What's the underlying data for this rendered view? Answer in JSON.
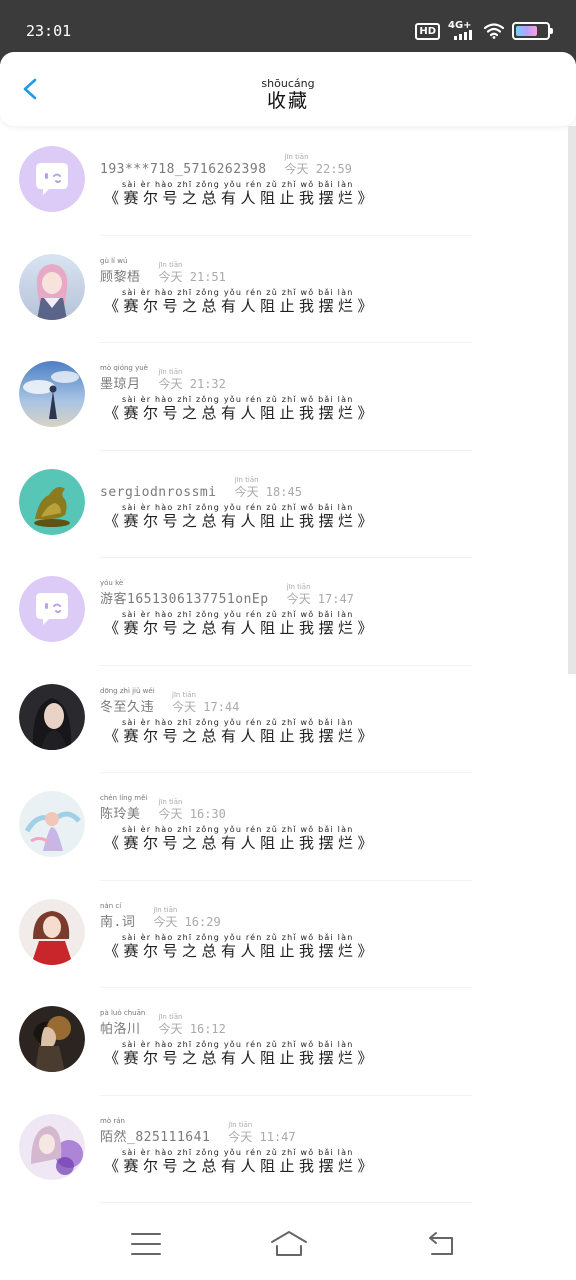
{
  "status": {
    "time": "23:01",
    "hd": "HD",
    "network": "4G+",
    "battery_level": 0.7,
    "icons": [
      "hd-icon",
      "signal-icon",
      "wifi-icon",
      "battery-icon"
    ]
  },
  "header": {
    "back_icon": "chevron-left-icon",
    "title_pinyin": "shōucáng",
    "title": "收藏",
    "accent": "#1e9be8"
  },
  "post": {
    "title": "《赛尔号之总有人阻止我摆烂》",
    "pinyin": "sài èr hào zhī zǒng yǒu rén zǔ zhǐ wǒ bǎi làn"
  },
  "items": [
    {
      "name": "193***718_5716262398",
      "name_pinyin": "",
      "time": "今天 22:59",
      "time_pinyin": "jīn tiān",
      "post": "《赛尔号之总有人阻止我摆烂》",
      "post_pinyin": "sài èr hào zhī zǒng yǒu rén zǔ zhǐ wǒ bǎi làn",
      "avatar": "default-chat-avatar"
    },
    {
      "name": "顾黎梧",
      "name_pinyin": "gù lí wú",
      "time": "今天 21:51",
      "time_pinyin": "jīn tiān",
      "post": "《赛尔号之总有人阻止我摆烂》",
      "post_pinyin": "sài èr hào zhī zǒng yǒu rén zǔ zhǐ wǒ bǎi làn",
      "avatar": "anime-girl-avatar"
    },
    {
      "name": "墨琼月",
      "name_pinyin": "mò qióng yuè",
      "time": "今天 21:32",
      "time_pinyin": "jīn tiān",
      "post": "《赛尔号之总有人阻止我摆烂》",
      "post_pinyin": "sài èr hào zhī zǒng yǒu rén zǔ zhǐ wǒ bǎi làn",
      "avatar": "sky-figure-avatar"
    },
    {
      "name": "sergiodnrossmi",
      "name_pinyin": "",
      "time": "今天 18:45",
      "time_pinyin": "jīn tiān",
      "post": "《赛尔号之总有人阻止我摆烂》",
      "post_pinyin": "sài èr hào zhī zǒng yǒu rén zǔ zhǐ wǒ bǎi làn",
      "avatar": "gold-dragon-avatar"
    },
    {
      "name": "游客1651306137751onEp",
      "name_pinyin": "yóu kè",
      "time": "今天 17:47",
      "time_pinyin": "jīn tiān",
      "post": "《赛尔号之总有人阻止我摆烂》",
      "post_pinyin": "sài èr hào zhī zǒng yǒu rén zǔ zhǐ wǒ bǎi làn",
      "avatar": "default-chat-avatar"
    },
    {
      "name": "冬至久违",
      "name_pinyin": "dōng zhì jiǔ wéi",
      "time": "今天 17:44",
      "time_pinyin": "jīn tiān",
      "post": "《赛尔号之总有人阻止我摆烂》",
      "post_pinyin": "sài èr hào zhī zǒng yǒu rén zǔ zhǐ wǒ bǎi làn",
      "avatar": "portrait-avatar"
    },
    {
      "name": "陈玲美",
      "name_pinyin": "chén líng měi",
      "time": "今天 16:30",
      "time_pinyin": "jīn tiān",
      "post": "《赛尔号之总有人阻止我摆烂》",
      "post_pinyin": "sài èr hào zhī zǒng yǒu rén zǔ zhǐ wǒ bǎi làn",
      "avatar": "fantasy-art-avatar"
    },
    {
      "name": "南.词",
      "name_pinyin": "nán cí",
      "time": "今天 16:29",
      "time_pinyin": "jīn tiān",
      "post": "《赛尔号之总有人阻止我摆烂》",
      "post_pinyin": "sài èr hào zhī zǒng yǒu rén zǔ zhǐ wǒ bǎi làn",
      "avatar": "red-dress-avatar"
    },
    {
      "name": "帕洛川",
      "name_pinyin": "pà luò chuān",
      "time": "今天 16:12",
      "time_pinyin": "jīn tiān",
      "post": "《赛尔号之总有人阻止我摆烂》",
      "post_pinyin": "sài èr hào zhī zǒng yǒu rén zǔ zhǐ wǒ bǎi làn",
      "avatar": "dark-art-avatar"
    },
    {
      "name": "陌然_825111641",
      "name_pinyin": "mò rán",
      "time": "今天 11:47",
      "time_pinyin": "jīn tiān",
      "post": "《赛尔号之总有人阻止我摆烂》",
      "post_pinyin": "sài èr hào zhī zǒng yǒu rén zǔ zhǐ wǒ bǎi làn",
      "avatar": "purple-flower-avatar"
    }
  ],
  "navbar": {
    "icons": [
      "menu-icon",
      "home-icon",
      "back-nav-icon"
    ]
  }
}
